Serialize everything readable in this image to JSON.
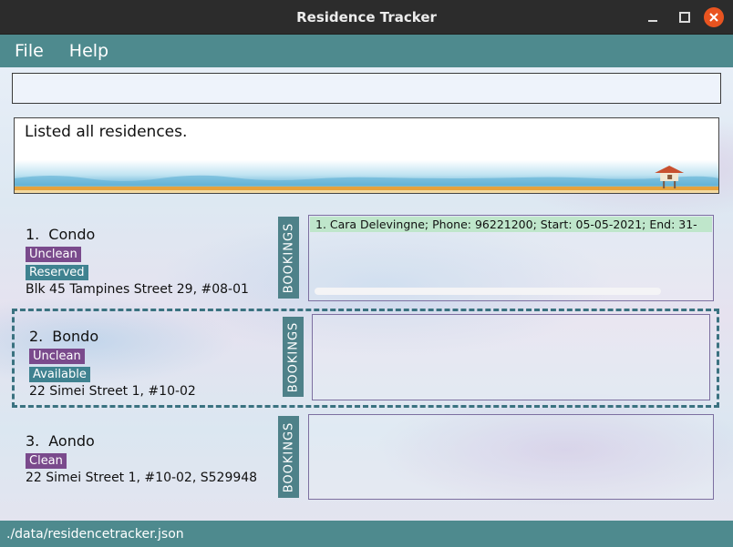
{
  "window": {
    "title": "Residence Tracker"
  },
  "menu": {
    "items": [
      "File",
      "Help"
    ]
  },
  "command": {
    "value": ""
  },
  "result": {
    "text": "Listed all residences."
  },
  "residences": [
    {
      "index": "1.",
      "name": "Condo",
      "tags": [
        {
          "label": "Unclean",
          "color": "#7a4a8c"
        },
        {
          "label": "Reserved",
          "color": "#3f8290"
        }
      ],
      "address": "Blk 45 Tampines Street 29, #08-01",
      "bookings_label": "BOOKINGS",
      "bookings": [
        "1. Cara Delevingne; Phone: 96221200; Start: 05-05-2021; End: 31-"
      ]
    },
    {
      "index": "2.",
      "name": "Bondo",
      "tags": [
        {
          "label": "Unclean",
          "color": "#7a4a8c"
        },
        {
          "label": "Available",
          "color": "#3f8290"
        }
      ],
      "address": "22 Simei Street 1, #10-02",
      "bookings_label": "BOOKINGS",
      "bookings": []
    },
    {
      "index": "3.",
      "name": "Aondo",
      "tags": [
        {
          "label": "Clean",
          "color": "#7a4a8c"
        }
      ],
      "address": "22 Simei Street 1, #10-02, S529948",
      "bookings_label": "BOOKINGS",
      "bookings": []
    }
  ],
  "status": {
    "path": "./data/residencetracker.json"
  },
  "colors": {
    "accent": "#4e8a8e",
    "tag_purple": "#7a4a8c",
    "tag_teal": "#3f8290",
    "booking_highlight": "#bfe6cb"
  }
}
